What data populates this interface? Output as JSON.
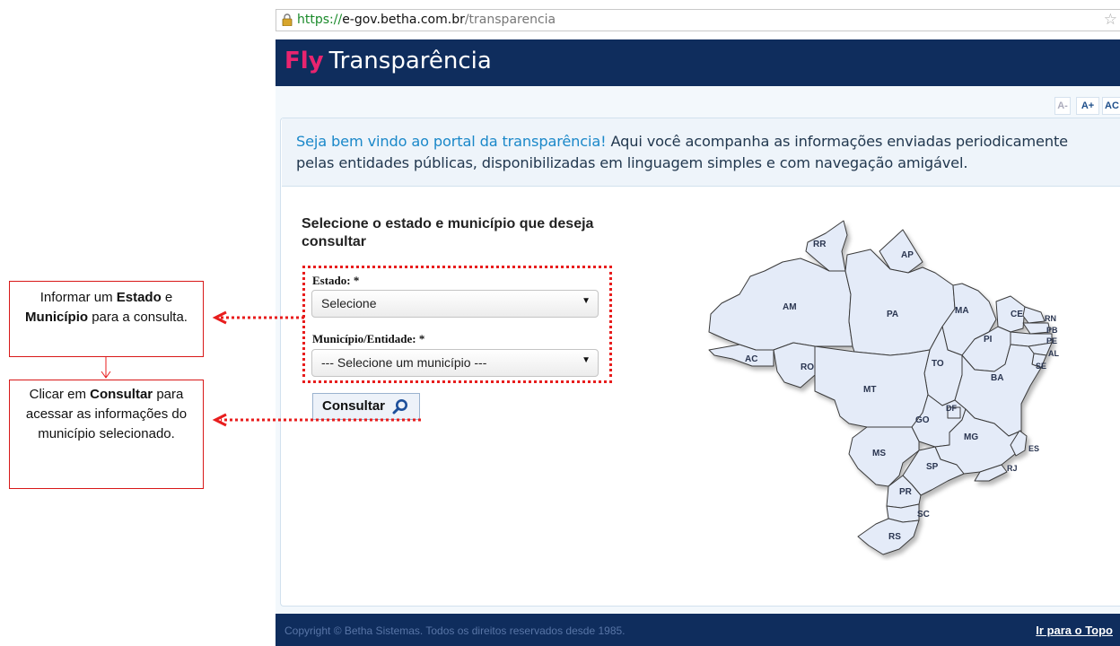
{
  "browser": {
    "url_scheme": "https://",
    "url_domain": "e-gov.betha.com.br",
    "url_path": "/transparencia",
    "star_icon": "bookmark-star-icon"
  },
  "header": {
    "brand_fly": "Fly",
    "brand_rest": "Transparência",
    "brand_color": "#e8246f",
    "bar_color": "#0f2d5d"
  },
  "font_controls": {
    "decrease": "A-",
    "increase": "A+",
    "contrast": "AC"
  },
  "welcome": {
    "highlight": "Seja bem vindo ao portal da transparência!",
    "text": " Aqui você acompanha as informações enviadas periodicamente pelas entidades públicas, disponibilizadas em linguagem simples e com navegação amigável."
  },
  "form": {
    "title": "Selecione o estado e município que deseja consultar",
    "estado_label": "Estado: *",
    "estado_value": "Selecione",
    "municipio_label": "Município/Entidade: *",
    "municipio_value": "--- Selecione um município ---",
    "submit_label": "Consultar"
  },
  "map": {
    "states": [
      "RR",
      "AP",
      "AM",
      "PA",
      "MA",
      "CE",
      "RN",
      "PB",
      "PE",
      "PI",
      "AL",
      "SE",
      "AC",
      "RO",
      "TO",
      "BA",
      "MT",
      "DF",
      "GO",
      "MG",
      "ES",
      "MS",
      "SP",
      "RJ",
      "PR",
      "SC",
      "RS"
    ]
  },
  "annotations": {
    "note1_pre": "Informar um ",
    "note1_b1": "Estado",
    "note1_mid1": " e ",
    "note1_b2": "Município",
    "note1_post": " para a consulta.",
    "note2_pre": "Clicar em ",
    "note2_b": "Consultar",
    "note2_post": " para acessar as informações do município selecionado.",
    "accent_color": "#e81d1d"
  },
  "footer": {
    "copyright": "Copyright © Betha Sistemas. Todos os direitos reservados desde 1985.",
    "to_top": "Ir para o Topo"
  }
}
